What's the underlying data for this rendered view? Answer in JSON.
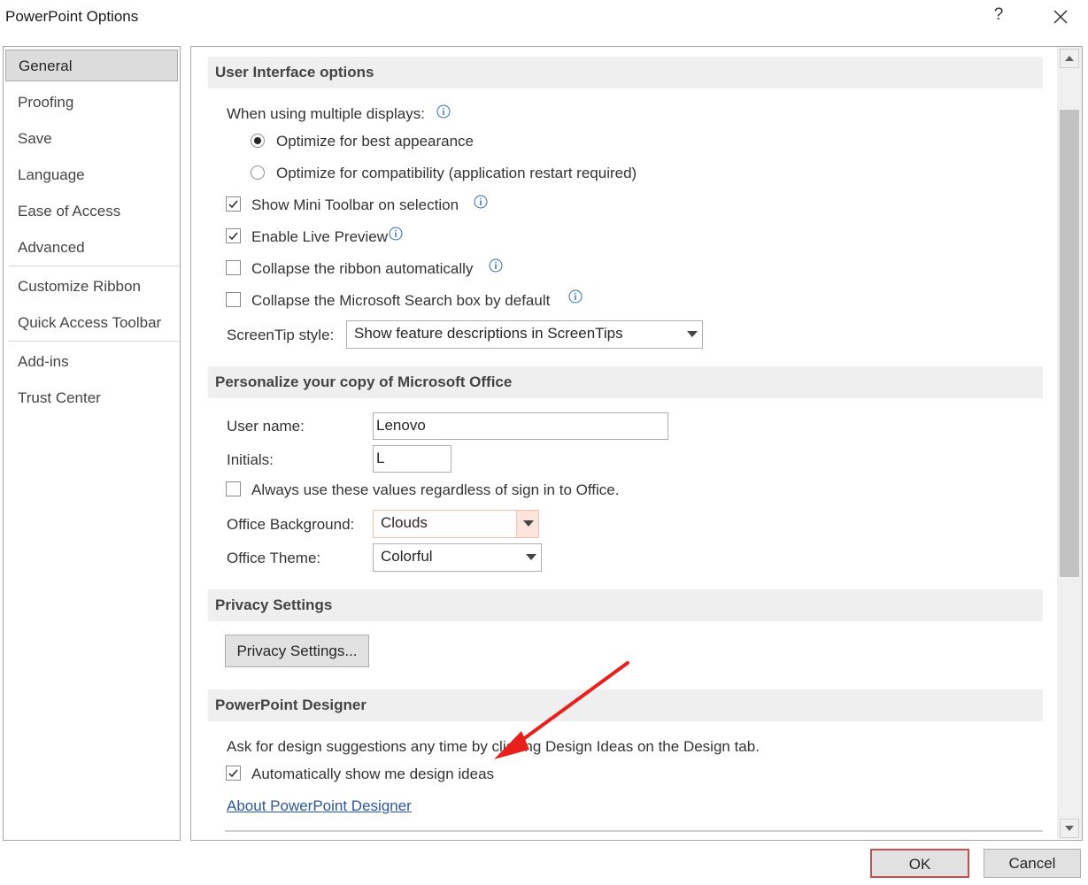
{
  "window": {
    "title": "PowerPoint Options",
    "help_label": "?",
    "close_icon": "close-icon"
  },
  "sidebar": {
    "items": [
      {
        "label": "General",
        "selected": true
      },
      {
        "label": "Proofing"
      },
      {
        "label": "Save"
      },
      {
        "label": "Language"
      },
      {
        "label": "Ease of Access"
      },
      {
        "label": "Advanced"
      },
      {
        "label": "Customize Ribbon"
      },
      {
        "label": "Quick Access Toolbar"
      },
      {
        "label": "Add-ins"
      },
      {
        "label": "Trust Center"
      }
    ]
  },
  "ui_options": {
    "heading": "User Interface options",
    "multi_display_label": "When using multiple displays:",
    "radio_best": "Optimize for best appearance",
    "radio_best_selected": true,
    "radio_compat": "Optimize for compatibility (application restart required)",
    "radio_compat_selected": false,
    "mini_toolbar": {
      "label": "Show Mini Toolbar on selection",
      "checked": true
    },
    "live_preview": {
      "label": "Enable Live Preview",
      "checked": true
    },
    "collapse_ribbon": {
      "label": "Collapse the ribbon automatically",
      "checked": false
    },
    "collapse_search": {
      "label": "Collapse the Microsoft Search box by default",
      "checked": false
    },
    "screentip_label": "ScreenTip style:",
    "screentip_value": "Show feature descriptions in ScreenTips"
  },
  "personalize": {
    "heading": "Personalize your copy of Microsoft Office",
    "username_label": "User name:",
    "username_value": "Lenovo",
    "initials_label": "Initials:",
    "initials_value": "L",
    "always_use": {
      "label": "Always use these values regardless of sign in to Office.",
      "checked": false
    },
    "background_label": "Office Background:",
    "background_value": "Clouds",
    "theme_label": "Office Theme:",
    "theme_value": "Colorful"
  },
  "privacy": {
    "heading": "Privacy Settings",
    "button_label": "Privacy Settings..."
  },
  "designer": {
    "heading": "PowerPoint Designer",
    "description": "Ask for design suggestions any time by clicking Design Ideas on the Design tab.",
    "auto_show": {
      "label": "Automatically show me design ideas",
      "checked": true
    },
    "about_link": "About PowerPoint Designer"
  },
  "footer": {
    "ok_label": "OK",
    "cancel_label": "Cancel"
  },
  "colors": {
    "ok_highlight": "#c0504d",
    "annotation_arrow": "#e8201c",
    "link": "#2b579a",
    "info_icon": "#2b6cb0"
  }
}
